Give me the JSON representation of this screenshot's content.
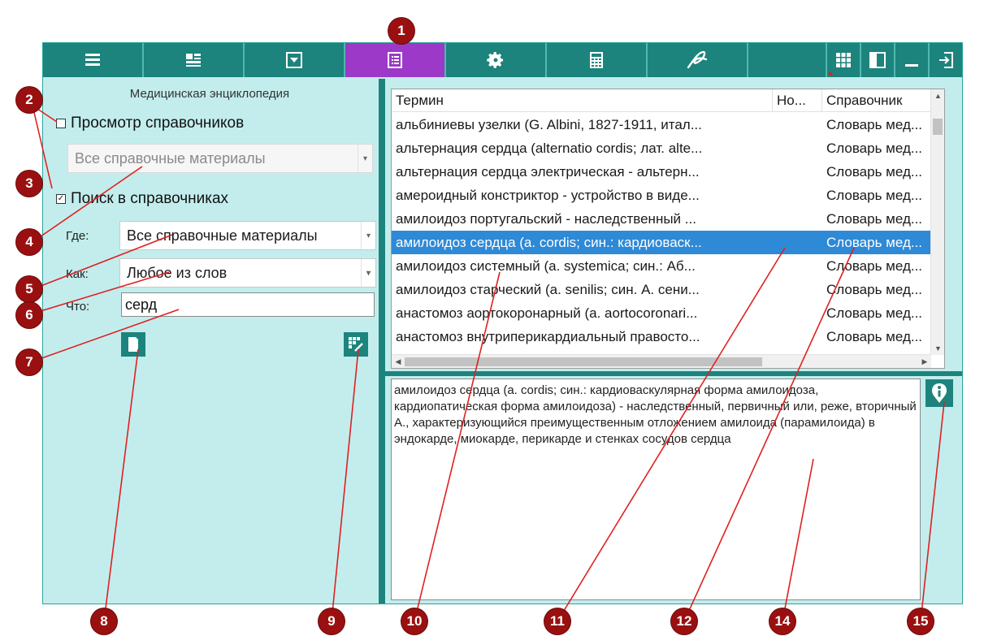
{
  "colors": {
    "toolbar": "#1d837d",
    "toolbar_active": "#9c39c8",
    "panel_bg": "#c3eded",
    "selection": "#2e89d6",
    "callout": "#9a1010"
  },
  "toolbar": {
    "buttons": [
      {
        "icon": "list-lines-icon"
      },
      {
        "icon": "document-layout-icon"
      },
      {
        "icon": "dropdown-box-icon"
      },
      {
        "icon": "reference-book-icon",
        "active": true
      },
      {
        "icon": "gear-icon"
      },
      {
        "icon": "calculator-icon"
      },
      {
        "icon": "signature-icon"
      }
    ],
    "right_buttons": [
      {
        "icon": "grid-icon"
      },
      {
        "icon": "panel-split-icon"
      },
      {
        "icon": "minimize-icon"
      },
      {
        "icon": "exit-icon"
      }
    ]
  },
  "left": {
    "encyclopedia_title": "Медицинская энциклопедия",
    "browse_label": "Просмотр справочников",
    "browse_checked": false,
    "browse_combo": "Все справочные материалы",
    "search_label": "Поиск в справочниках",
    "search_checked": true,
    "where_label": "Где:",
    "where_value": "Все справочные материалы",
    "how_label": "Как:",
    "how_value": "Любое из слов",
    "what_label": "Что:",
    "what_value": "серд"
  },
  "grid": {
    "columns": [
      "Термин",
      "Но...",
      "Справочник"
    ],
    "rows": [
      {
        "term": "альбиниевы узелки (G. Albini, 1827-1911, итал...",
        "no": "",
        "ref": "Словарь мед..."
      },
      {
        "term": "альтернация сердца (alternatio cordis; лат. alte...",
        "no": "",
        "ref": "Словарь мед..."
      },
      {
        "term": "альтернация сердца электрическая - альтерн...",
        "no": "",
        "ref": "Словарь мед..."
      },
      {
        "term": "амероидный констриктор - устройство в виде...",
        "no": "",
        "ref": "Словарь мед..."
      },
      {
        "term": "амилоидоз португальский - наследственный ...",
        "no": "",
        "ref": "Словарь мед..."
      },
      {
        "term": "амилоидоз сердца (a. cordis; син.: кардиоваск...",
        "no": "",
        "ref": "Словарь мед...",
        "selected": true
      },
      {
        "term": "амилоидоз системный (a. systemica; син.: Аб...",
        "no": "",
        "ref": "Словарь мед..."
      },
      {
        "term": "амилоидоз старческий (a. senilis; син. А. сени...",
        "no": "",
        "ref": "Словарь мед..."
      },
      {
        "term": "анастомоз аортокоронарный (a. aortocoronari...",
        "no": "",
        "ref": "Словарь мед..."
      },
      {
        "term": "анастомоз внутриперикардиальный правосто...",
        "no": "",
        "ref": "Словарь мед..."
      }
    ]
  },
  "description": "амилоидоз сердца (a. cordis; син.: кардиоваскулярная форма амилоидоза, кардиопатическая форма амилоидоза) - наследственный, первичный или, реже, вторичный А., характеризующийся преимущественным отложением амилоида (парамилоида) в эндокарде, миокарде, перикарде и стенках сосудов сердца",
  "callouts": [
    "1",
    "2",
    "3",
    "4",
    "5",
    "6",
    "7",
    "8",
    "9",
    "10",
    "11",
    "12",
    "14",
    "15"
  ]
}
